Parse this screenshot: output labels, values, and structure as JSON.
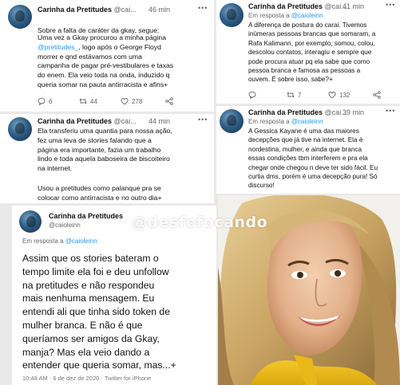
{
  "tweet1": {
    "name": "Carinha da Pretitudes",
    "handle": "@cai...",
    "time": "46 min",
    "text_a": "Sobre a falta de caráter da gkay, segue:",
    "text_b1": "Uma vez a Gkay procurou a minha página",
    "text_link": "@pretitudes_",
    "text_b2": ", logo após o George Floyd\nmorrer e qnd estávamos com uma\ncampanha de pagar pré-vestibulares e taxas\ndo enem. Ela veio toda na onda, induzido q\nqueria somar na pauta antirracista e afins+",
    "replies": "6",
    "retweets": "44",
    "likes": "278"
  },
  "tweet2": {
    "name": "Carinha da Pretitudes",
    "handle": "@cai...",
    "time": "44 min",
    "text_a": "Ela transferiu uma quantia para nossa ação,\nfez uma leva de stories falando que a\npágina era importante, fazia um trabalho\nlindo e toda aquela baboseira de biscoiteiro\nna internet.",
    "text_b": "Usou a pretitudes como palanque pra se\ncolocar como antirracista e no outro dia+"
  },
  "tweet3": {
    "name": "Carinha da Pretitudes",
    "handle": "@caioleinn",
    "reply_prefix": "Em resposta a",
    "reply_to": "@caioleinn",
    "text": "Assim que os stories bateram o\ntempo limite ela foi e deu unfollow\nna pretitudes e não respondeu\nmais nenhuma mensagem. Eu\nentendi ali que tinha sido token de\nmulher branca. E não é que\nqueríamos ser amigos da Gkay,\nmanja? Mas ela veio dando a\nentender que queria somar, mas...+",
    "meta": "10:48 AM · 6 de dez de 2020 · Twitter for iPhone"
  },
  "tweet4": {
    "name": "Carinha da Pretitudes",
    "handle": "@cai...",
    "time": "41 min",
    "reply_prefix": "Em resposta a",
    "reply_to": "@caioleinn",
    "text": "A diferença de postura do carai. Tivemos\ninúmeras pessoas brancas que somaram, a\nRafa Kalimann, por exemplo, somou, colou,\ndescolou contatos, interagiu e sempre que\npode procura atuar pq ela sabe que como\npessoa branca e famosa as pessoas a\nouvem. É sobre isso, sabe?+",
    "replies": "",
    "retweets": "7",
    "likes": "132"
  },
  "tweet5": {
    "name": "Carinha da Pretitudes",
    "handle": "@cai...",
    "time": "39 min",
    "reply_prefix": "Em resposta a",
    "reply_to": "@caioleinn",
    "text": "A Gessica Kayane é uma das maiores\ndecepções que já tive na internet. Ela é\nnordestina, mulher, e ainda que branca\nessas condições tbm interferem e pra ela\nchegar onde chegou n deve ter sido fácil. Eu\ncurtia dms, porém é uma decepção pura! Só\ndiscurso!"
  },
  "watermark": "@desfofocando",
  "icons": {
    "reply": "reply-icon",
    "retweet": "retweet-icon",
    "like": "heart-icon",
    "share": "share-icon",
    "more": "more-icon"
  },
  "colors": {
    "link": "#1d9bf0",
    "muted": "#666666",
    "photo_warm": "#d7b57a"
  }
}
